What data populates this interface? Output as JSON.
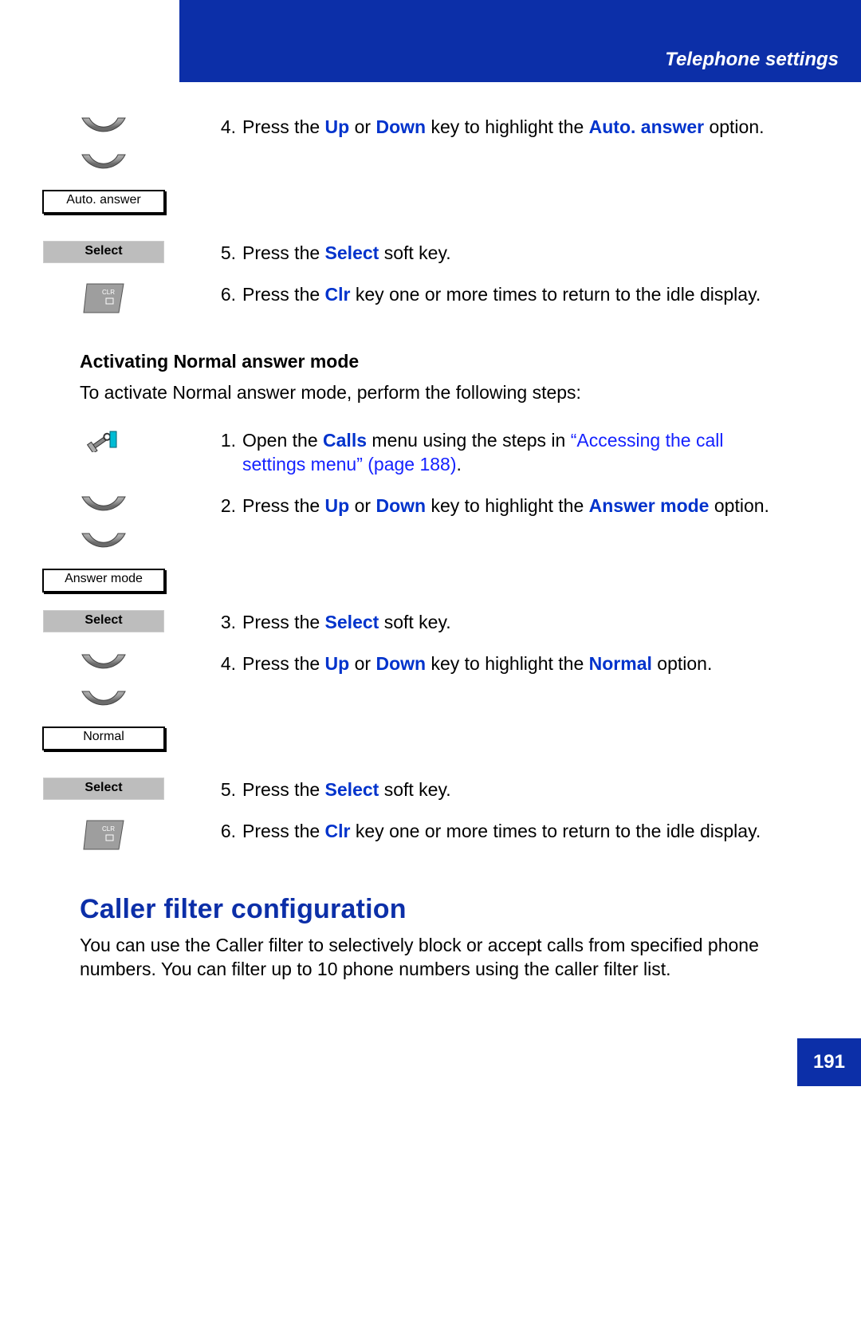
{
  "header": {
    "title": "Telephone settings"
  },
  "pageNumber": "191",
  "block1": {
    "step4": {
      "num": "4.",
      "pre": "Press the ",
      "up": "Up",
      "mid": " or ",
      "down": "Down",
      "post": " key to highlight the ",
      "opt1": "Auto.",
      "opt2": "answer",
      "tail": " option.",
      "box": "Auto. answer"
    },
    "step5": {
      "num": "5.",
      "pre": "Press the ",
      "key": "Select",
      "post": " soft key.",
      "btn": "Select"
    },
    "step6": {
      "num": "6.",
      "pre": "Press the ",
      "key": "Clr",
      "post": " key one or more times to return to the idle display."
    }
  },
  "block2": {
    "heading": "Activating Normal answer mode",
    "intro": "To activate Normal answer mode, perform the following steps:",
    "step1": {
      "num": "1.",
      "pre": "Open the ",
      "bold": "Calls",
      "mid": " menu using the steps in ",
      "link": "“Accessing the call settings menu” (page 188)",
      "post": "."
    },
    "step2": {
      "num": "2.",
      "pre": "Press the ",
      "up": "Up",
      "mid": " or ",
      "down": "Down",
      "post": " key to highlight the ",
      "opt1": "Answer",
      "opt2": "mode",
      "tail": " option.",
      "box": "Answer mode"
    },
    "step3": {
      "num": "3.",
      "pre": "Press the ",
      "key": "Select",
      "post": " soft key.",
      "btn": "Select"
    },
    "step4": {
      "num": "4.",
      "pre": "Press the ",
      "up": "Up",
      "mid": " or ",
      "down": "Down",
      "post": " key to highlight the ",
      "opt1": "Normal",
      "tail": " option.",
      "box": "Normal"
    },
    "step5": {
      "num": "5.",
      "pre": "Press the ",
      "key": "Select",
      "post": " soft key.",
      "btn": "Select"
    },
    "step6": {
      "num": "6.",
      "pre": "Press the ",
      "key": "Clr",
      "post": " key one or more times to return to the idle display."
    }
  },
  "section": {
    "title": "Caller filter configuration",
    "body": "You can use the Caller filter to selectively block or accept calls from specified phone numbers. You can filter up to 10 phone numbers using the caller filter list."
  }
}
